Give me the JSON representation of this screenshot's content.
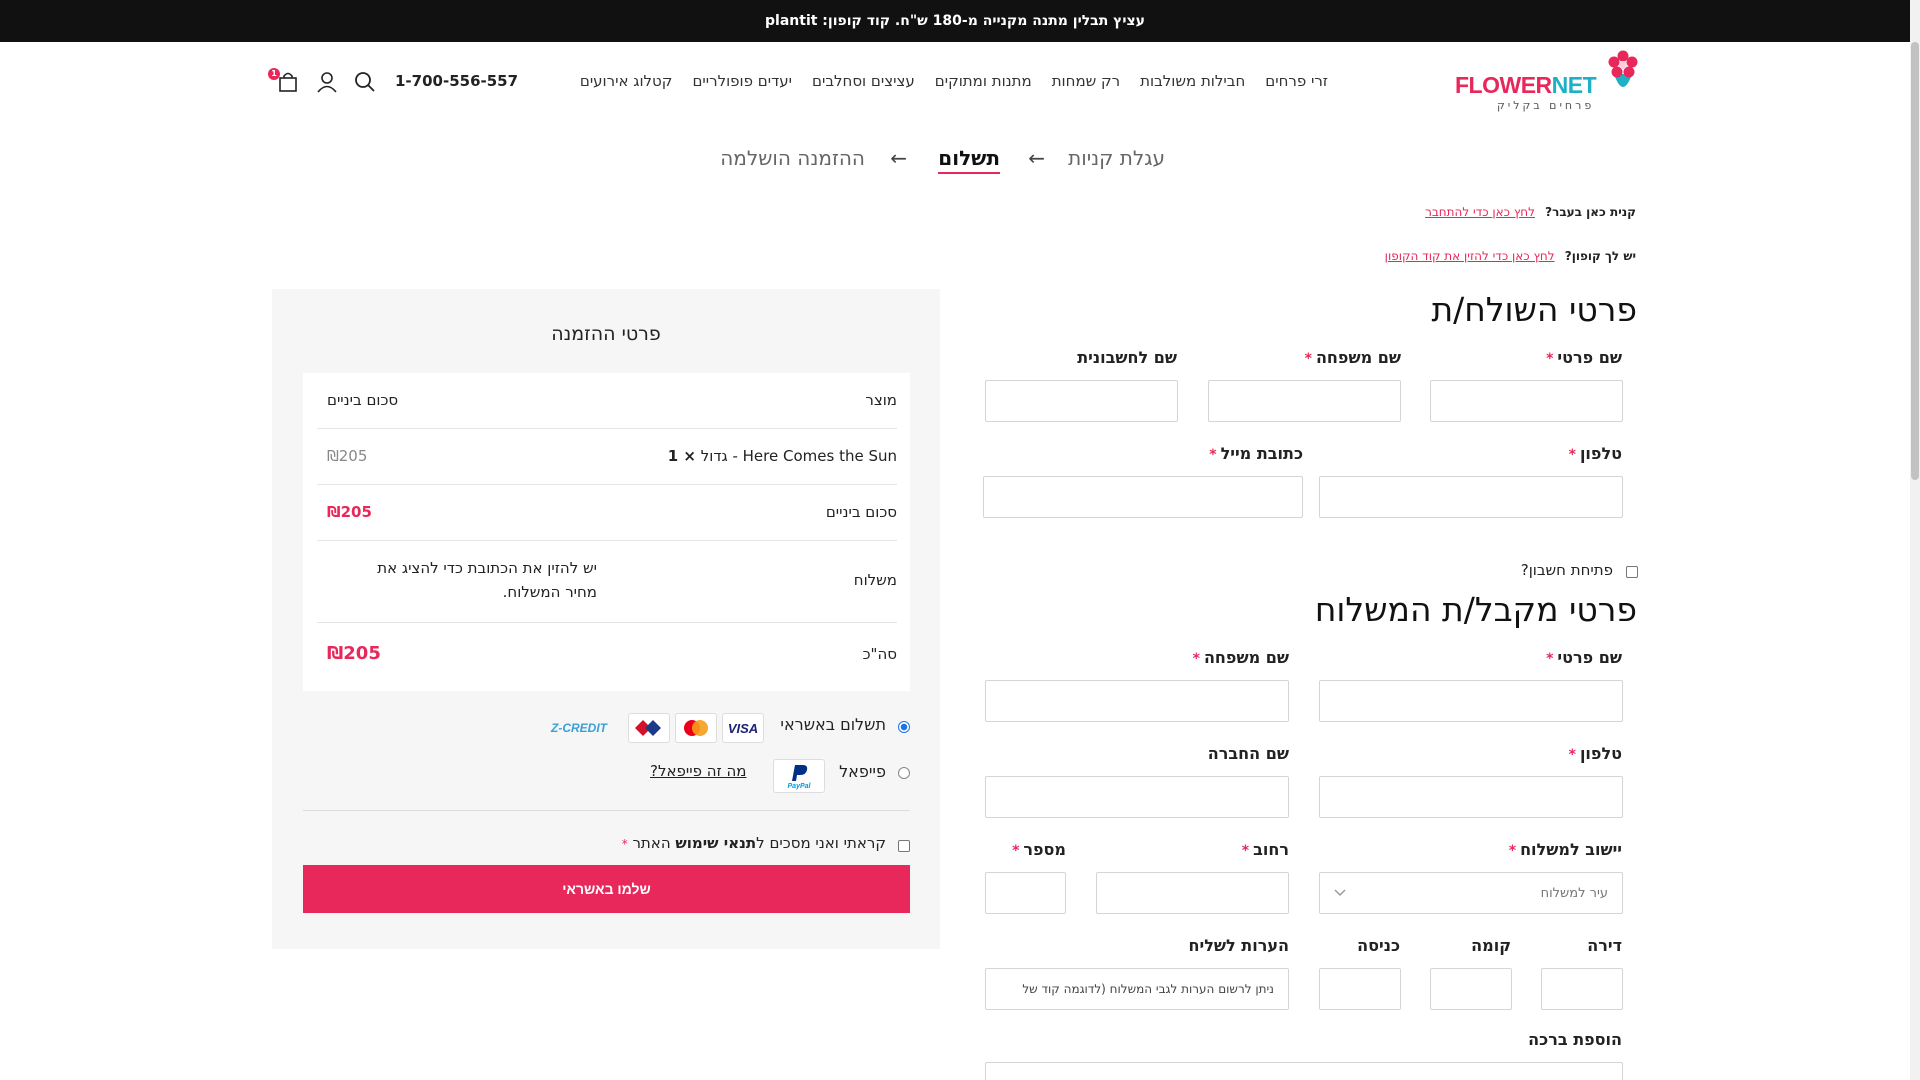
{
  "topbar": {
    "promo": "עציץ תבלין מתנה מקנייה מ-180 ש\"ח. קוד קופון: plantit"
  },
  "logo": {
    "brand_part1": "FLOWER",
    "brand_part2": "NET",
    "tagline": "פרחים בקליק"
  },
  "nav": {
    "items": [
      "זרי פרחים",
      "חבילות משולבות",
      "רק שמחות",
      "מתנות ומתוקים",
      "עציצים וסחלבים",
      "יעדים פופולריים",
      "קטלוג אירועים"
    ],
    "phone": "1-700-556-557",
    "cart_count": "1"
  },
  "steps": {
    "cart": "עגלת קניות",
    "payment": "תשלום",
    "complete": "ההזמנה הושלמה",
    "arrow": "←"
  },
  "notices": {
    "login_q": "קנית כאן בעבר?",
    "login_link": "לחץ כאן כדי להתחבר",
    "coupon_q": "יש לך קופון?",
    "coupon_link": "לחץ כאן כדי להזין את קוד הקופון"
  },
  "sender": {
    "title": "פרטי השולח/ת",
    "first_name": "שם פרטי",
    "last_name": "שם משפחה",
    "invoice_name": "שם לחשבונית",
    "phone": "טלפון",
    "email": "כתובת מייל",
    "create_account": "פתיחת חשבון?"
  },
  "recipient": {
    "title": "פרטי מקבל/ת המשלוח",
    "first_name": "שם פרטי",
    "last_name": "שם משפחה",
    "phone": "טלפון",
    "company": "שם החברה",
    "city": "יישוב למשלוח",
    "city_placeholder": "עיר למשלוח",
    "street": "רחוב",
    "number": "מספר",
    "apartment": "דירה",
    "floor": "קומה",
    "entrance": "כניסה",
    "courier_notes": "הערות לשליח",
    "courier_notes_placeholder": "ניתן לרשום הערות לגבי המשלוח (לדוגמה קוד של",
    "greeting": "הוספת ברכה"
  },
  "order": {
    "title": "פרטי ההזמנה",
    "col_product": "מוצר",
    "col_subtotal": "סכום ביניים",
    "item_name": "Here Comes the Sun - גדול",
    "item_qty": "× 1",
    "item_price": "₪205",
    "subtotal_label": "סכום ביניים",
    "subtotal_value": "₪205",
    "shipping_label": "משלוח",
    "shipping_line1": "יש להזין את הכתובת כדי להציג את",
    "shipping_line2": "מחיר המשלוח.",
    "total_label": "סה\"כ",
    "total_value": "₪205"
  },
  "payment": {
    "credit_label": "תשלום באשראי",
    "paypal_label": "פייפאל",
    "paypal_what": "מה זה פייפאל?",
    "terms_prefix": "קראתי ואני מסכים ל",
    "terms_link": "תנאי שימוש",
    "terms_suffix": " האתר",
    "pay_button": "שלמו באשראי",
    "card_visa": "VISA",
    "card_zcredit": "Z-CREDIT",
    "paypal_mark": "PayPal"
  },
  "colors": {
    "accent": "#e8285a",
    "teal": "#1fb0c6",
    "topbar": "#111111"
  }
}
